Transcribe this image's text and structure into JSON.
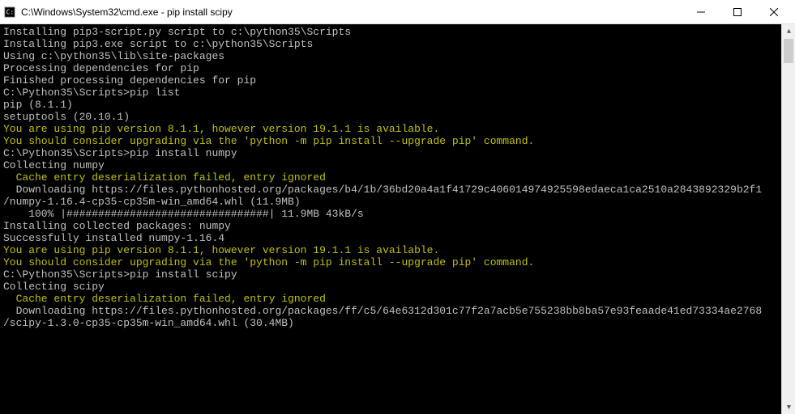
{
  "window": {
    "title": "C:\\Windows\\System32\\cmd.exe - pip  install scipy"
  },
  "lines": [
    {
      "text": "Installing pip3-script.py script to c:\\python35\\Scripts",
      "cls": ""
    },
    {
      "text": "Installing pip3.exe script to c:\\python35\\Scripts",
      "cls": ""
    },
    {
      "text": "",
      "cls": ""
    },
    {
      "text": "Using c:\\python35\\lib\\site-packages",
      "cls": ""
    },
    {
      "text": "Processing dependencies for pip",
      "cls": ""
    },
    {
      "text": "Finished processing dependencies for pip",
      "cls": ""
    },
    {
      "text": "",
      "cls": ""
    },
    {
      "text": "C:\\Python35\\Scripts>pip list",
      "cls": ""
    },
    {
      "text": "pip (8.1.1)",
      "cls": ""
    },
    {
      "text": "setuptools (20.10.1)",
      "cls": ""
    },
    {
      "text": "You are using pip version 8.1.1, however version 19.1.1 is available.",
      "cls": "warn"
    },
    {
      "text": "You should consider upgrading via the 'python -m pip install --upgrade pip' command.",
      "cls": "warn"
    },
    {
      "text": "",
      "cls": ""
    },
    {
      "text": "C:\\Python35\\Scripts>pip install numpy",
      "cls": ""
    },
    {
      "text": "Collecting numpy",
      "cls": ""
    },
    {
      "text": "  Cache entry deserialization failed, entry ignored",
      "cls": "warn"
    },
    {
      "text": "  Downloading https://files.pythonhosted.org/packages/b4/1b/36bd20a4a1f41729c406014974925598edaeca1ca2510a2843892329b2f1",
      "cls": ""
    },
    {
      "text": "/numpy-1.16.4-cp35-cp35m-win_amd64.whl (11.9MB)",
      "cls": ""
    },
    {
      "text": "    100% |################################| 11.9MB 43kB/s",
      "cls": ""
    },
    {
      "text": "Installing collected packages: numpy",
      "cls": ""
    },
    {
      "text": "Successfully installed numpy-1.16.4",
      "cls": ""
    },
    {
      "text": "You are using pip version 8.1.1, however version 19.1.1 is available.",
      "cls": "warn"
    },
    {
      "text": "You should consider upgrading via the 'python -m pip install --upgrade pip' command.",
      "cls": "warn"
    },
    {
      "text": "",
      "cls": ""
    },
    {
      "text": "C:\\Python35\\Scripts>pip install scipy",
      "cls": ""
    },
    {
      "text": "Collecting scipy",
      "cls": ""
    },
    {
      "text": "  Cache entry deserialization failed, entry ignored",
      "cls": "warn"
    },
    {
      "text": "  Downloading https://files.pythonhosted.org/packages/ff/c5/64e6312d301c77f2a7acb5e755238bb8ba57e93feaade41ed73334ae2768",
      "cls": ""
    },
    {
      "text": "/scipy-1.3.0-cp35-cp35m-win_amd64.whl (30.4MB)",
      "cls": ""
    }
  ]
}
